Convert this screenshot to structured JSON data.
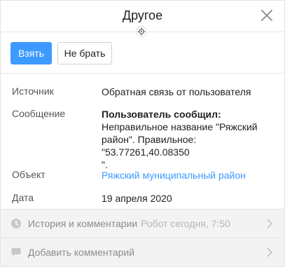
{
  "header": {
    "title": "Другое",
    "close_icon": "close-icon",
    "locate_icon": "crosshair-icon"
  },
  "actions": {
    "take_label": "Взять",
    "skip_label": "Не брать"
  },
  "details": {
    "source_label": "Источник",
    "source_value": "Обратная связь от пользователя",
    "message_label": "Сообщение",
    "message_head": "Пользователь сообщил:",
    "message_line1": "Неправильное название \"Ряжский",
    "message_line2": "район\". Правильное: \"53.77261,40.08350",
    "message_line3": "\".",
    "object_label": "Объект",
    "object_value": "Ряжский муниципальный район",
    "date_label": "Дата",
    "date_value": "19 апреля 2020"
  },
  "footer": {
    "history_label": "История и комментарии",
    "history_meta": "Робот сегодня, 7:50",
    "history_icon": "clock-icon",
    "comment_label": "Добавить комментарий",
    "comment_icon": "comment-icon",
    "chevron_icon": "chevron-right-icon"
  },
  "colors": {
    "accent": "#3d9aff",
    "footer_bg": "#f3f3f3",
    "muted_text": "#8c8c8c"
  }
}
